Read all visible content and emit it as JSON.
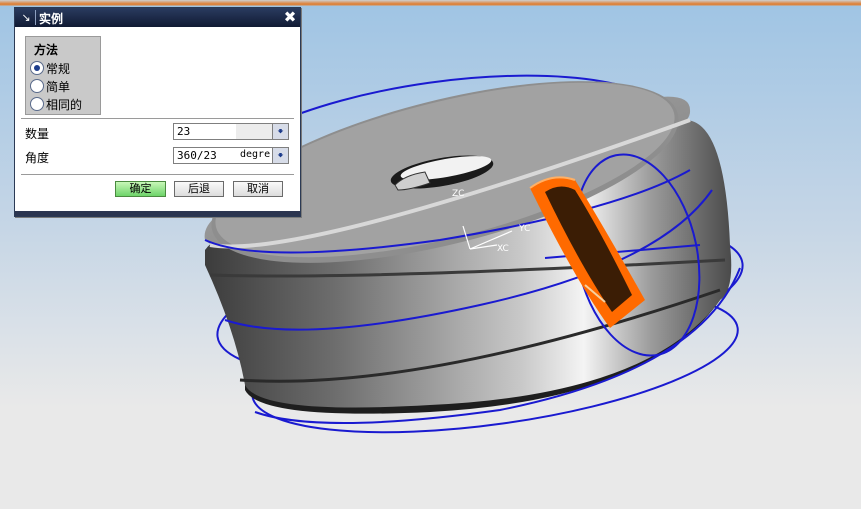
{
  "dialog": {
    "title": "实例",
    "method_group": {
      "title": "方法",
      "options": [
        {
          "label": "常规",
          "selected": true
        },
        {
          "label": "简单",
          "selected": false
        },
        {
          "label": "相同的",
          "selected": false
        }
      ]
    },
    "fields": [
      {
        "label": "数量",
        "value": "23",
        "unit": ""
      },
      {
        "label": "角度",
        "value": "360/23",
        "unit": "degre"
      }
    ],
    "buttons": {
      "ok": "确定",
      "back": "后退",
      "cancel": "取消"
    }
  },
  "viewport": {
    "axes": {
      "x": "XC",
      "y": "YC",
      "z": "ZC"
    },
    "colors": {
      "highlight": "#ff6a00",
      "curves": "#1a1ad0",
      "background_top": "#9fc4e4",
      "background_bottom": "#e9e9e9"
    }
  }
}
